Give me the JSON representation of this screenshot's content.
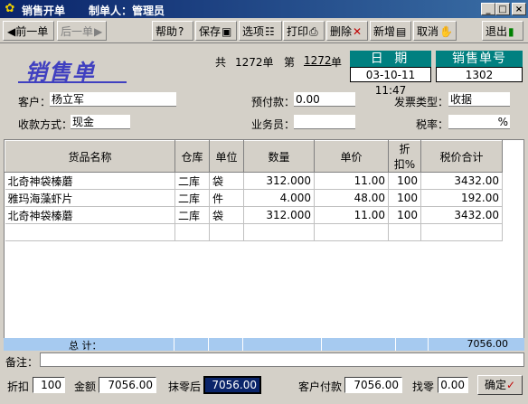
{
  "window": {
    "title": "销售开单",
    "maker": "制单人：管理员",
    "controls": {
      "min": "_",
      "max": "□",
      "close": "×"
    }
  },
  "toolbar": {
    "prev": "前一单",
    "next": "后一单",
    "help": "帮助",
    "save": "保存",
    "options": "选项",
    "print": "打印",
    "delete": "删除",
    "add": "新增",
    "cancel": "取消",
    "exit": "退出"
  },
  "header": {
    "logo": "销售单",
    "gong": "共",
    "total_count": "1272单",
    "di": "第",
    "current_no": "1272",
    "dan": "单",
    "date_label": "日  期",
    "date_value": "03-10-11 11:47",
    "order_no_label": "销售单号",
    "order_no_value": "1302"
  },
  "form": {
    "customer_label": "客户：",
    "customer_value": "杨立军",
    "prepay_label": "预付款：",
    "prepay_value": "0.00",
    "invoice_label": "发票类型：",
    "invoice_value": "收据",
    "payment_label": "收款方式：",
    "payment_value": "现金",
    "salesman_label": "业务员：",
    "salesman_value": "",
    "tax_label": "税率：",
    "tax_value": "%"
  },
  "table": {
    "columns": [
      "货品名称",
      "仓库",
      "单位",
      "数量",
      "单价",
      "折扣%",
      "税价合计"
    ],
    "rows": [
      [
        "北奇神袋榛蘑",
        "二库",
        "袋",
        "312.000",
        "11.00",
        "100",
        "3432.00"
      ],
      [
        "雅玛海藻虾片",
        "二库",
        "件",
        "4.000",
        "48.00",
        "100",
        "192.00"
      ],
      [
        "北奇神袋榛蘑",
        "二库",
        "袋",
        "312.000",
        "11.00",
        "100",
        "3432.00"
      ]
    ],
    "total_label": "总    计：",
    "total_value": "7056.00"
  },
  "remark": {
    "label": "备注：",
    "value": ""
  },
  "footer": {
    "discount_label": "折扣",
    "discount_value": "100",
    "amount_label": "金额",
    "amount_value": "7056.00",
    "after_round_label": "抹零后",
    "after_round_value": "7056.00",
    "customer_pay_label": "客户付款",
    "customer_pay_value": "7056.00",
    "change_label": "找零",
    "change_value": "0.00",
    "confirm": "确定"
  },
  "colors": {
    "titlebar": "#0a246a",
    "teal": "#008080",
    "logo": "#4040c0",
    "totals_bg": "#a6caf0"
  }
}
